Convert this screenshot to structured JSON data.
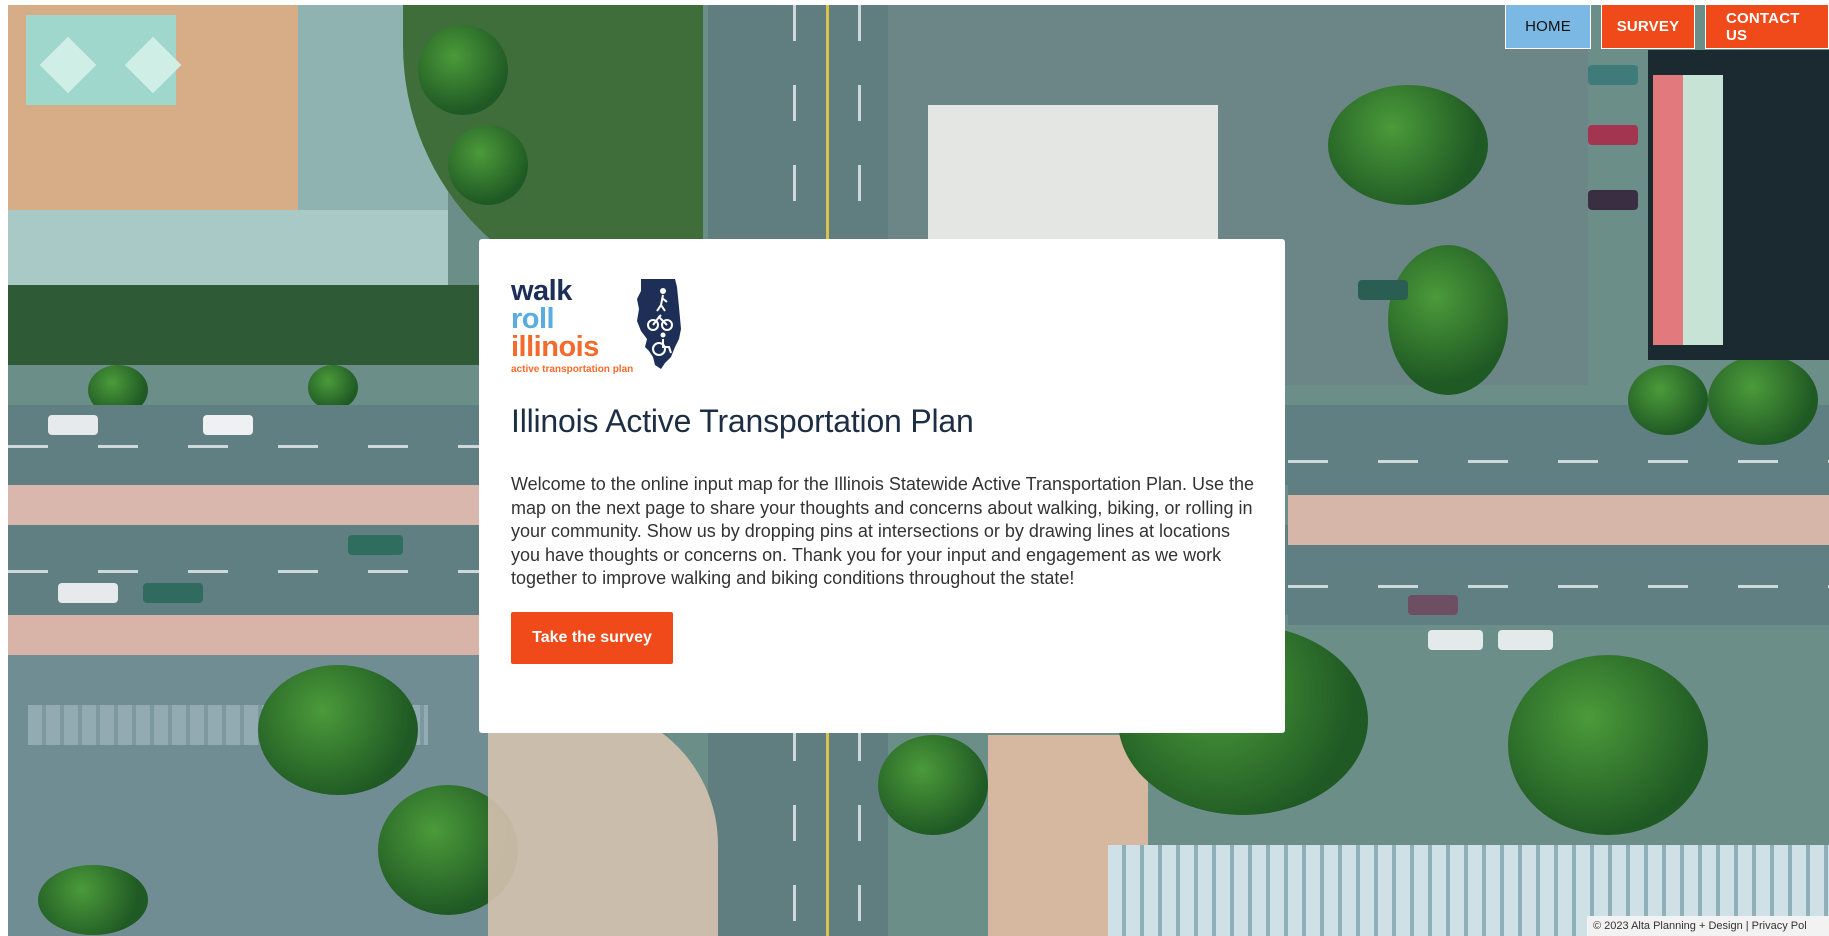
{
  "nav": {
    "items": [
      {
        "label": "HOME"
      },
      {
        "label": "SURVEY"
      },
      {
        "label": "CONTACT US"
      }
    ]
  },
  "logo": {
    "word1": "walk",
    "word2": "roll",
    "word3": "illinois",
    "tagline": "active transportation plan",
    "icon": "illinois-state-pedestrian-bike-wheelchair-icon"
  },
  "main": {
    "title": "Illinois Active Transportation Plan",
    "intro": "Welcome to the online input map for the Illinois Statewide Active Transportation Plan. Use the map on the next page to share your thoughts and concerns about walking, biking, or rolling in your community. Show us by dropping pins at intersections or by drawing lines at locations you have thoughts or concerns on. Thank you for your input and engagement as we work together to improve walking and biking conditions throughout the state!",
    "cta_label": "Take the survey"
  },
  "footer": {
    "copyright": "© 2023 Alta Planning + Design",
    "separator": "|",
    "privacy": "Privacy Pol"
  },
  "colors": {
    "accent": "#f04a1a",
    "home_nav": "#7bb8e4",
    "logo_navy": "#1d2e57",
    "logo_blue": "#58ade0",
    "logo_orange": "#f36b2c"
  }
}
